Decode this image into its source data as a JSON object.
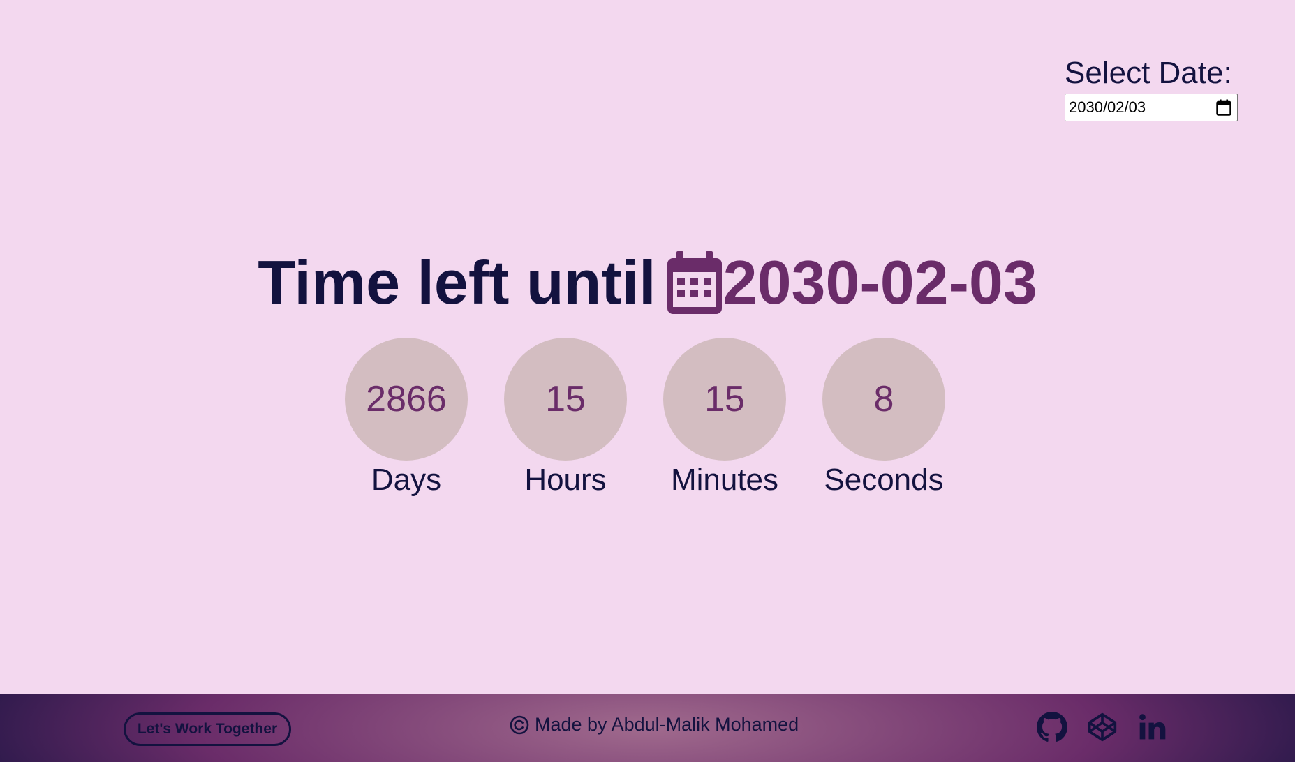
{
  "date_picker": {
    "label": "Select Date:",
    "value": "2030/02/03",
    "calendar_icon": "calendar-icon"
  },
  "heading": {
    "prefix": "Time left until",
    "icon": "calendar-icon",
    "target_date": "2030-02-03"
  },
  "countdown": {
    "days": {
      "value": "2866",
      "label": "Days"
    },
    "hours": {
      "value": "15",
      "label": "Hours"
    },
    "minutes": {
      "value": "15",
      "label": "Minutes"
    },
    "seconds": {
      "value": "8",
      "label": "Seconds"
    }
  },
  "footer": {
    "cta_label": "Let's Work Together",
    "credit": "Made by Abdul-Malik Mohamed",
    "copyright_icon": "copyright-icon",
    "socials": [
      {
        "icon": "github-icon"
      },
      {
        "icon": "codepen-icon"
      },
      {
        "icon": "linkedin-icon"
      }
    ]
  },
  "colors": {
    "background": "#f3d8ef",
    "text_dark": "#13123f",
    "accent": "#6a2c69",
    "circle": "#d3bdc1"
  }
}
